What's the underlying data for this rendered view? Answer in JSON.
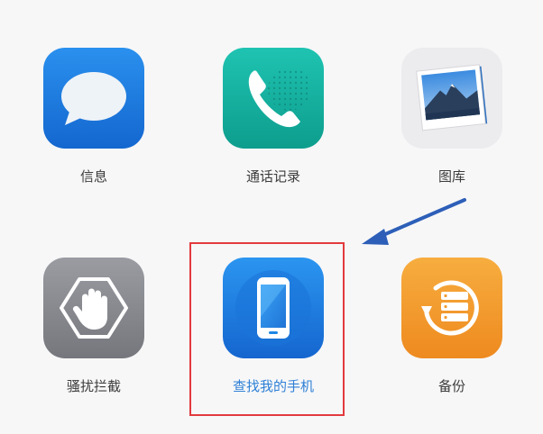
{
  "apps": [
    {
      "id": "messages",
      "label": "信息",
      "icon": "speech-bubble-icon",
      "color": "#1d7fe3"
    },
    {
      "id": "call-log",
      "label": "通话记录",
      "icon": "phone-handset-icon",
      "color": "#16b3a2"
    },
    {
      "id": "gallery",
      "label": "图库",
      "icon": "photo-stack-icon",
      "color": "#e9e9ec"
    },
    {
      "id": "harassment-blocking",
      "label": "骚扰拦截",
      "icon": "stop-hand-icon",
      "color": "#8a8c92"
    },
    {
      "id": "find-my-phone",
      "label": "查找我的手机",
      "icon": "smartphone-icon",
      "color": "#1e86e6",
      "highlighted": true
    },
    {
      "id": "backup",
      "label": "备份",
      "icon": "backup-restore-icon",
      "color": "#f39a2c"
    }
  ],
  "annotation": {
    "highlight_color": "#e23a3e",
    "arrow_color": "#2d5fb8"
  }
}
